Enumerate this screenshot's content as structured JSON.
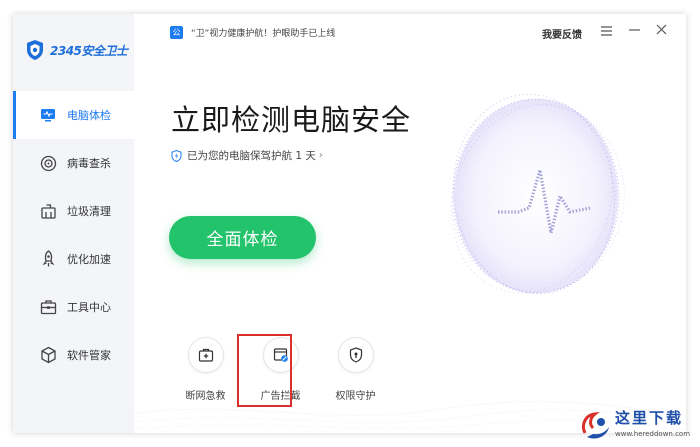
{
  "app": {
    "logo_text": "2345安全卫士",
    "brand_color": "#1e7cf2",
    "success_color": "#22c36b"
  },
  "topbar": {
    "notice_badge": "公",
    "notice_text": "“卫”视力健康护航！护眼助手已上线",
    "feedback_label": "我要反馈",
    "menu_icon": "menu-icon",
    "minimize_icon": "minimize-icon",
    "close_icon": "close-icon"
  },
  "sidebar": {
    "items": [
      {
        "label": "电脑体检",
        "icon": "monitor-icon",
        "active": true
      },
      {
        "label": "病毒查杀",
        "icon": "target-icon",
        "active": false
      },
      {
        "label": "垃圾清理",
        "icon": "trash-clean-icon",
        "active": false
      },
      {
        "label": "优化加速",
        "icon": "rocket-icon",
        "active": false
      },
      {
        "label": "工具中心",
        "icon": "toolbox-icon",
        "active": false
      },
      {
        "label": "软件管家",
        "icon": "cube-icon",
        "active": false
      }
    ]
  },
  "main": {
    "headline": "立即检测电脑安全",
    "protect_text": "已为您的电脑保驾护航 1 天",
    "scan_button": "全面体检"
  },
  "tools": [
    {
      "label": "断网急救",
      "icon": "network-rescue-icon"
    },
    {
      "label": "广告拦截",
      "icon": "ad-block-icon"
    },
    {
      "label": "权限守护",
      "icon": "permission-shield-icon"
    }
  ],
  "watermark": {
    "title": "这里下载",
    "url": "www.hereddown.com"
  }
}
